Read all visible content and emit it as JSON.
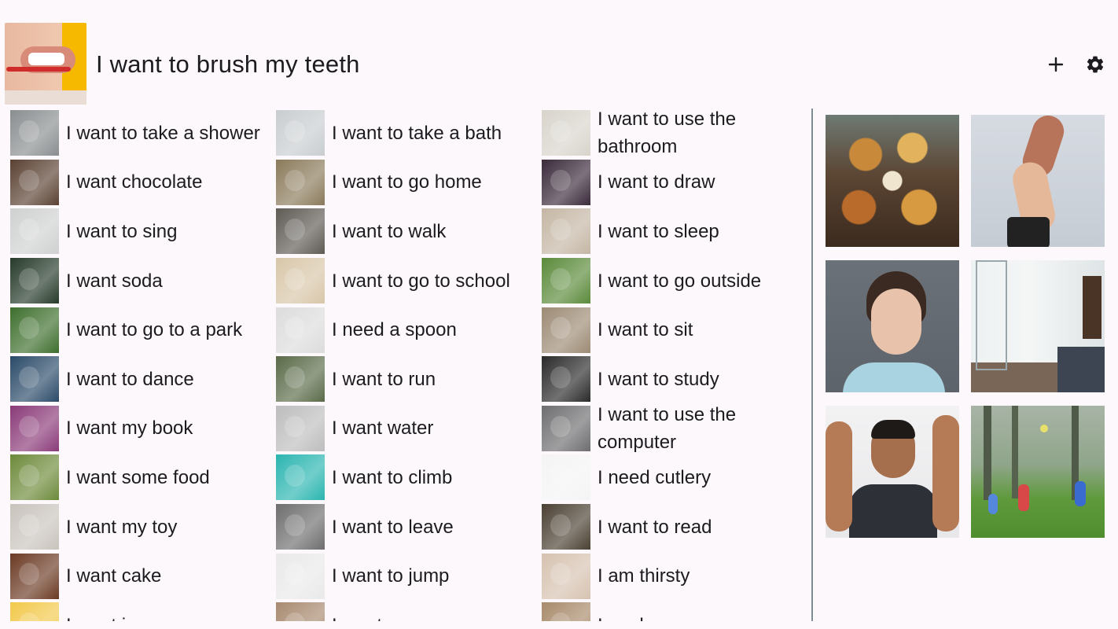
{
  "header": {
    "title": "I want to brush my teeth",
    "add_icon": "plus-icon",
    "settings_icon": "gear-icon"
  },
  "phrases": [
    [
      "I want to take a shower",
      "I want chocolate",
      "I want to sing",
      "I want soda",
      "I want to go to a park",
      "I want to dance",
      "I want my book",
      "I want some food",
      "I want my toy",
      "I want cake",
      "I want ice cream"
    ],
    [
      "I want to take a bath",
      "I want to go home",
      "I want to walk",
      "I want to go to school",
      "I need a spoon",
      "I want to run",
      "I want water",
      "I want to climb",
      "I want to leave",
      "I want to jump",
      "I want my mom"
    ],
    [
      "I want to use the bathroom",
      "I want to draw",
      "I want to sleep",
      "I want to go outside",
      "I want to sit",
      "I want to study",
      "I want to use the computer",
      "I need cutlery",
      "I want to read",
      "I am thirsty",
      "I am hungry"
    ]
  ],
  "colors": {
    "background": "#fcf8fc",
    "divider": "#7f8c93",
    "text": "#1c1b1f"
  }
}
